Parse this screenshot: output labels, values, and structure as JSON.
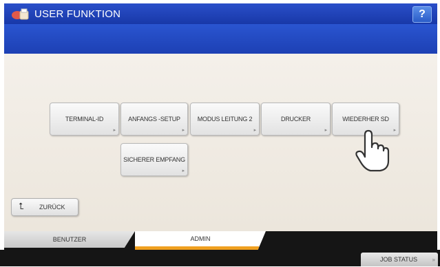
{
  "header": {
    "title": "USER FUNKTION",
    "help_label": "?"
  },
  "menu": {
    "buttons": [
      {
        "label": "TERMINAL-ID"
      },
      {
        "label": "ANFANGS -SETUP"
      },
      {
        "label": "MODUS LEITUNG 2"
      },
      {
        "label": "DRUCKER"
      },
      {
        "label": "WIEDERHER SD"
      },
      {
        "label": "SICHERER EMPFANG"
      }
    ],
    "arrow_glyph": "▸"
  },
  "back": {
    "label": "ZURÜCK",
    "glyph": "⮤"
  },
  "tabs": [
    {
      "label": "BENUTZER"
    },
    {
      "label": "ADMIN"
    }
  ],
  "active_tab": "ADMIN",
  "status": {
    "job_status_label": "JOB STATUS",
    "arrow": "»"
  },
  "colors": {
    "title_blue": "#2a4fc9",
    "active_tab_accent": "#f0a020",
    "dark_bar": "#151515"
  },
  "icons": [
    "printer-logo-icon",
    "help-icon",
    "hand-pointer-icon",
    "back-arrow-icon"
  ]
}
